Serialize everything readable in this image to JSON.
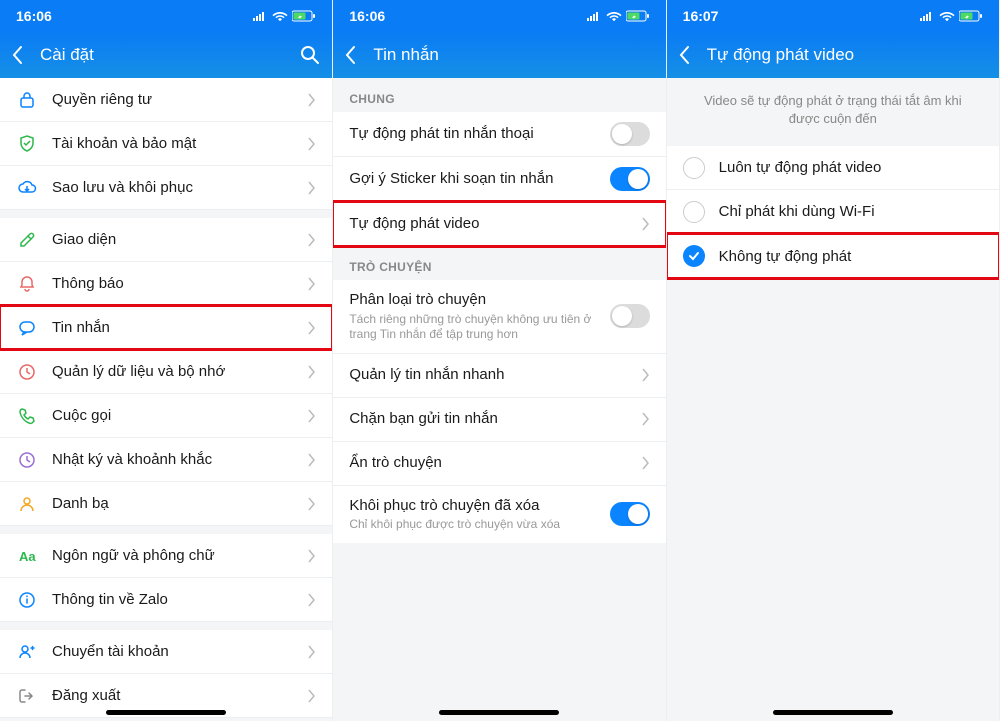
{
  "s1": {
    "time": "16:06",
    "title": "Cài đặt",
    "rows": [
      {
        "icon": "lock",
        "label": "Quyền riêng tư",
        "hl": false
      },
      {
        "icon": "shield",
        "label": "Tài khoản và bảo mật",
        "hl": false
      },
      {
        "icon": "cloud",
        "label": "Sao lưu và khôi phục",
        "hl": false
      },
      {
        "gap": true
      },
      {
        "icon": "brush",
        "label": "Giao diện",
        "hl": false
      },
      {
        "icon": "bell",
        "label": "Thông báo",
        "hl": false
      },
      {
        "icon": "message",
        "label": "Tin nhắn",
        "hl": true
      },
      {
        "icon": "clock",
        "label": "Quản lý dữ liệu và bộ nhớ",
        "hl": false
      },
      {
        "icon": "phone",
        "label": "Cuộc gọi",
        "hl": false
      },
      {
        "icon": "moments",
        "label": "Nhật ký và khoảnh khắc",
        "hl": false
      },
      {
        "icon": "person",
        "label": "Danh bạ",
        "hl": false
      },
      {
        "gap": true
      },
      {
        "icon": "lang",
        "label": "Ngôn ngữ và phông chữ",
        "hl": false
      },
      {
        "icon": "info",
        "label": "Thông tin về Zalo",
        "hl": false
      },
      {
        "gap": true
      },
      {
        "icon": "switch",
        "label": "Chuyển tài khoản",
        "hl": false
      },
      {
        "icon": "logout",
        "label": "Đăng xuất",
        "hl": false
      }
    ]
  },
  "s2": {
    "time": "16:06",
    "title": "Tin nhắn",
    "sec1": "CHUNG",
    "sec2": "TRÒ CHUYỆN",
    "r1": {
      "label": "Tự động phát tin nhắn thoại",
      "toggle": "off"
    },
    "r2": {
      "label": "Gợi ý Sticker khi soạn tin nhắn",
      "toggle": "on"
    },
    "r3": {
      "label": "Tự động phát video",
      "hl": true
    },
    "r4": {
      "label": "Phân loại trò chuyện",
      "sub": "Tách riêng những trò chuyện không ưu tiên ở trang Tin nhắn để tập trung hơn",
      "toggle": "off"
    },
    "r5": {
      "label": "Quản lý tin nhắn nhanh"
    },
    "r6": {
      "label": "Chặn bạn gửi tin nhắn"
    },
    "r7": {
      "label": "Ẩn trò chuyện"
    },
    "r8": {
      "label": "Khôi phục trò chuyện đã xóa",
      "sub": "Chỉ khôi phục được trò chuyện vừa xóa",
      "toggle": "on"
    }
  },
  "s3": {
    "time": "16:07",
    "title": "Tự động phát video",
    "desc": "Video sẽ tự động phát ở trạng thái tắt âm khi được cuộn đến",
    "opts": [
      {
        "label": "Luôn tự động phát video",
        "checked": false,
        "hl": false
      },
      {
        "label": "Chỉ phát khi dùng Wi-Fi",
        "checked": false,
        "hl": false
      },
      {
        "label": "Không tự động phát",
        "checked": true,
        "hl": true
      }
    ]
  }
}
